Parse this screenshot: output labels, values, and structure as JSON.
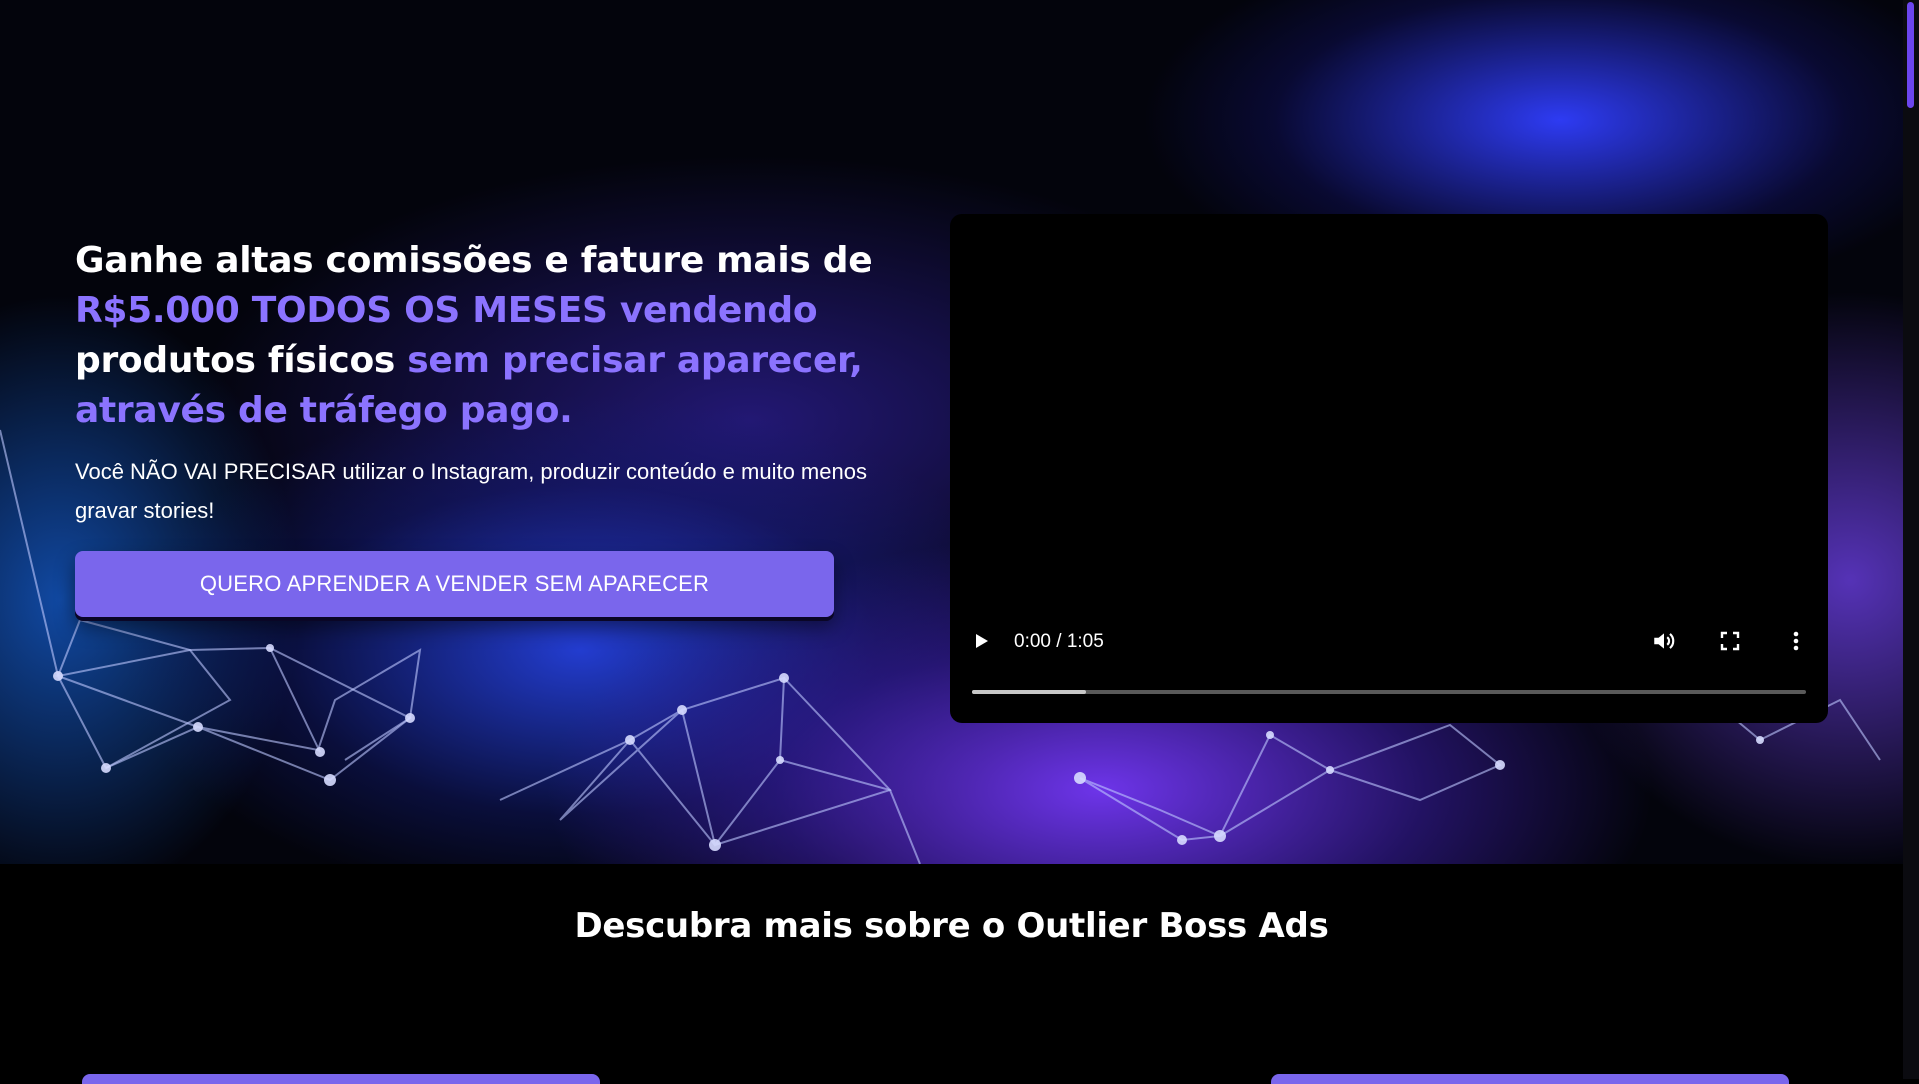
{
  "hero": {
    "headline": {
      "part1": "Ganhe altas comissões e fature mais de ",
      "part2_accent": "R$5.000 TODOS OS MESES vendendo",
      "part3": " produtos físicos",
      "part4_accent": " sem precisar aparecer, através de tráfego pago."
    },
    "subtext": "Você NÃO VAI PRECISAR utilizar o Instagram, produzir conteúdo e muito menos gravar stories!",
    "cta_label": "QUERO APRENDER A VENDER SEM APARECER"
  },
  "video": {
    "time": "0:00 / 1:05",
    "buffered_fraction": 0.137,
    "icons": [
      "play-icon",
      "volume-icon",
      "fullscreen-icon",
      "more-vertical-icon"
    ]
  },
  "section": {
    "title": "Descubra mais sobre o Outlier Boss Ads"
  },
  "colors": {
    "accent": "#8b73ff",
    "button": "#7a66ec",
    "background": "#000000"
  }
}
